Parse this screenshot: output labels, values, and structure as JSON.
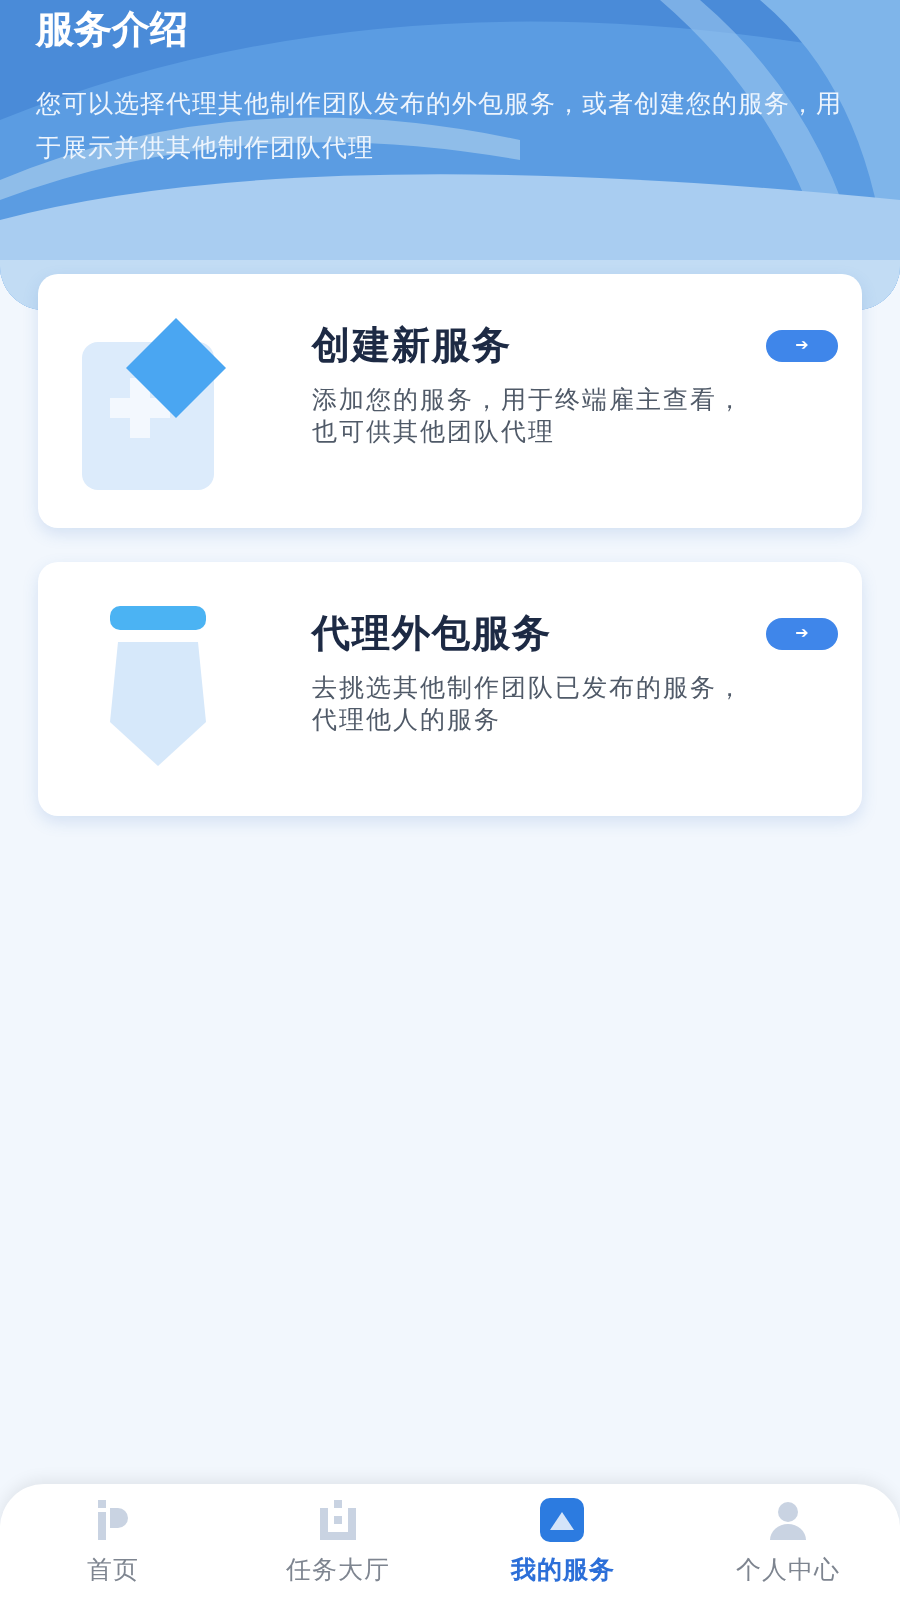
{
  "header": {
    "title": "服务介绍",
    "description": "您可以选择代理其他制作团队发布的外包服务，或者创建您的服务，用于展示并供其他制作团队代理"
  },
  "cards": [
    {
      "kind": "create",
      "title": "创建新服务",
      "description": "添加您的服务，用于终端雇主查看，也可供其他团队代理",
      "arrow": "➔"
    },
    {
      "kind": "agent",
      "title": "代理外包服务",
      "description": "去挑选其他制作团队已发布的服务，代理他人的服务",
      "arrow": "➔"
    }
  ],
  "tabs": [
    {
      "kind": "home",
      "label": "首页",
      "selected": false
    },
    {
      "kind": "hall",
      "label": "任务大厅",
      "selected": false
    },
    {
      "kind": "service",
      "label": "我的服务",
      "selected": true
    },
    {
      "kind": "profile",
      "label": "个人中心",
      "selected": false
    }
  ]
}
